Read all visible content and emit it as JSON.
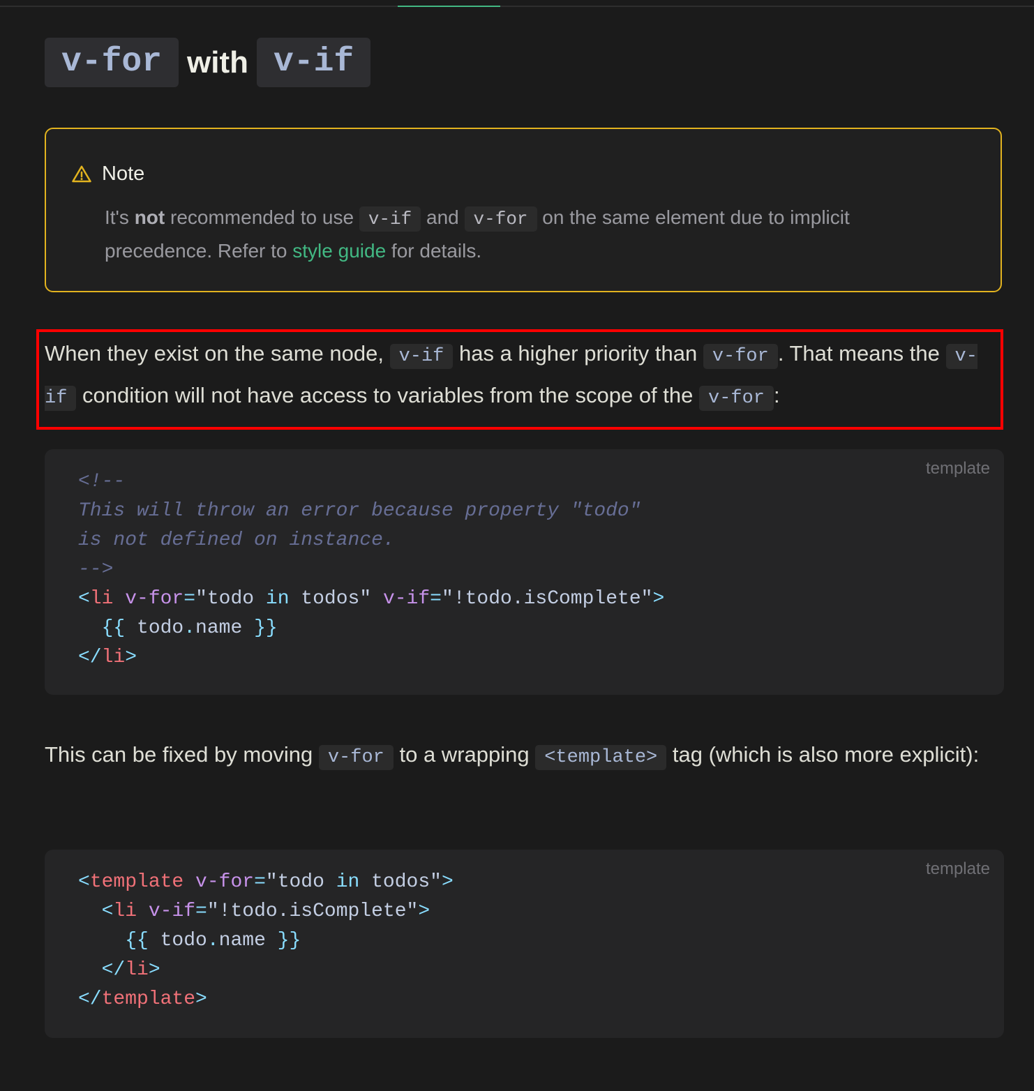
{
  "heading": {
    "code1": "v-for",
    "word": "with",
    "code2": "v-if"
  },
  "note": {
    "title": "Note",
    "t1": "It's ",
    "bold": "not",
    "t2": " recommended to use ",
    "c1": "v-if",
    "t3": " and ",
    "c2": "v-for",
    "t4": " on the same element due to implicit precedence. Refer to ",
    "link": "style guide",
    "t5": " for details."
  },
  "para1": {
    "t1": "When they exist on the same node, ",
    "c1": "v-if",
    "t2": " has a higher priority than ",
    "c2": "v-for",
    "t3": ". That means the ",
    "c3": "v-if",
    "t4": " condition will not have access to variables from the scope of the ",
    "c4": "v-for",
    "t5": ":"
  },
  "code1": {
    "lang": "template",
    "l1": "<!--",
    "l2": "This will throw an error because property \"todo\"",
    "l3": "is not defined on instance.",
    "l4": "-->",
    "l5a": "<",
    "l5b": "li",
    "l5c": " v-for",
    "l5d": "=",
    "l5e": "\"",
    "l5f": "todo ",
    "l5g": "in",
    "l5h": " todos",
    "l5i": "\"",
    "l5j": " v-if",
    "l5k": "=",
    "l5l": "\"",
    "l5m": "!todo.isComplete",
    "l5n": "\"",
    "l5o": ">",
    "l6a": "  {{ ",
    "l6b": "todo",
    "l6c": ".",
    "l6d": "name",
    "l6e": " }}",
    "l7a": "</",
    "l7b": "li",
    "l7c": ">"
  },
  "para2": {
    "t1": "This can be fixed by moving ",
    "c1": "v-for",
    "t2": " to a wrapping ",
    "c2": "<template>",
    "t3": " tag (which is also more explicit):"
  },
  "code2": {
    "lang": "template",
    "l1a": "<",
    "l1b": "template",
    "l1c": " v-for",
    "l1d": "=",
    "l1e": "\"",
    "l1f": "todo ",
    "l1g": "in",
    "l1h": " todos",
    "l1i": "\"",
    "l1j": ">",
    "l2a": "  <",
    "l2b": "li",
    "l2c": " v-if",
    "l2d": "=",
    "l2e": "\"",
    "l2f": "!todo.isComplete",
    "l2g": "\"",
    "l2h": ">",
    "l3a": "    {{ ",
    "l3b": "todo",
    "l3c": ".",
    "l3d": "name",
    "l3e": " }}",
    "l4a": "  </",
    "l4b": "li",
    "l4c": ">",
    "l5a": "</",
    "l5b": "template",
    "l5c": ">"
  }
}
